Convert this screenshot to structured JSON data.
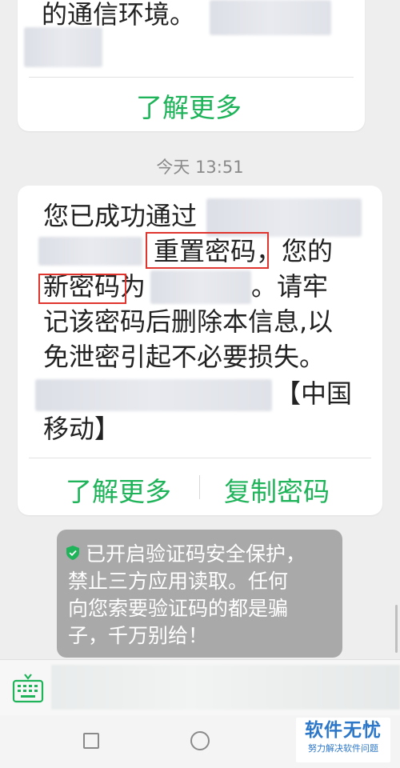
{
  "messages": [
    {
      "tail_text": "的通信环境。",
      "actions": [
        "了解更多"
      ]
    },
    {
      "lines": [
        "您已成功通过",
        "重置密码，您的",
        "新密码为",
        "。请牢",
        "记该密码后删除本信息,以",
        "免泄密引起不必要损失。",
        "【中国",
        "移动】"
      ],
      "actions": [
        "了解更多",
        "复制密码"
      ]
    }
  ],
  "timestamp": "今天 13:51",
  "security_notice": {
    "lines": [
      "已开启验证码安全保护，",
      "禁止三方应用读取。任何",
      "向您索要验证码的都是骗",
      "子，千万别给！"
    ],
    "icon": "shield-check-icon"
  },
  "input_bar": {
    "keyboard_icon": "keyboard-icon",
    "value": ""
  },
  "watermark": {
    "title": "软件无忧",
    "subtitle": "努力解决软件问题"
  },
  "colors": {
    "accent_green": "#1fb35a",
    "highlight_red": "#e0342f",
    "watermark_blue": "#2d77c9"
  }
}
